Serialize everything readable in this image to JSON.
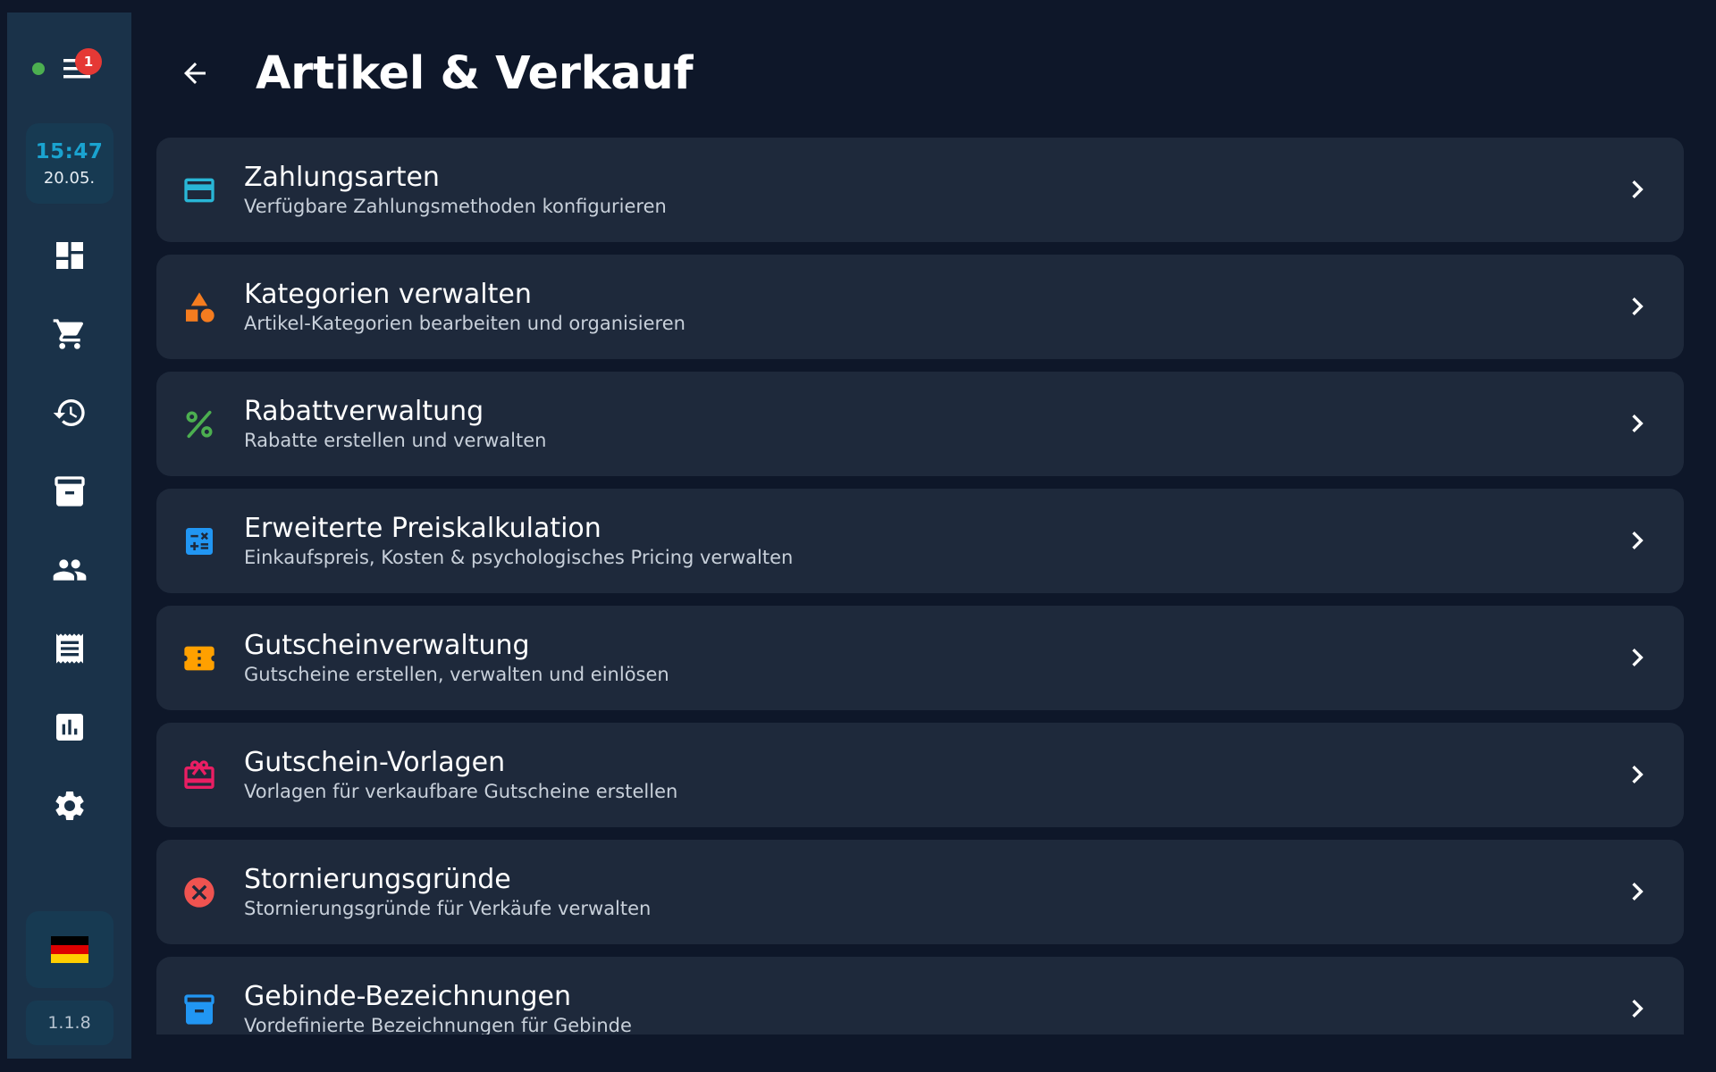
{
  "sidebar": {
    "menu_badge": "1",
    "clock": {
      "time": "15:47",
      "date": "20.05."
    },
    "nav": [
      "dashboard-icon",
      "cart-icon",
      "history-icon",
      "archive-icon",
      "people-icon",
      "receipt-icon",
      "chart-icon",
      "settings-icon"
    ],
    "language_flag": "🇩🇪",
    "version": "1.1.8"
  },
  "header": {
    "title": "Artikel & Verkauf"
  },
  "items": [
    {
      "title": "Zahlungsarten",
      "subtitle": "Verfügbare Zahlungsmethoden konfigurieren",
      "icon": "credit-card-icon",
      "color": "#29b6d6"
    },
    {
      "title": "Kategorien verwalten",
      "subtitle": "Artikel-Kategorien bearbeiten und organisieren",
      "icon": "category-icon",
      "color": "#f57c1f"
    },
    {
      "title": "Rabattverwaltung",
      "subtitle": "Rabatte erstellen und verwalten",
      "icon": "percent-icon",
      "color": "#4caf50"
    },
    {
      "title": "Erweiterte Preiskalkulation",
      "subtitle": "Einkaufspreis, Kosten & psychologisches Pricing verwalten",
      "icon": "calculator-icon",
      "color": "#2196f3"
    },
    {
      "title": "Gutscheinverwaltung",
      "subtitle": "Gutscheine erstellen, verwalten und einlösen",
      "icon": "voucher-icon",
      "color": "#ffa000"
    },
    {
      "title": "Gutschein-Vorlagen",
      "subtitle": "Vorlagen für verkaufbare Gutscheine erstellen",
      "icon": "gift-card-icon",
      "color": "#e91e63"
    },
    {
      "title": "Stornierungsgründe",
      "subtitle": "Stornierungsgründe für Verkäufe verwalten",
      "icon": "cancel-icon",
      "color": "#ef5350"
    },
    {
      "title": "Gebinde-Bezeichnungen",
      "subtitle": "Vordefinierte Bezeichnungen für Gebinde",
      "icon": "package-icon",
      "color": "#2196f3"
    }
  ]
}
